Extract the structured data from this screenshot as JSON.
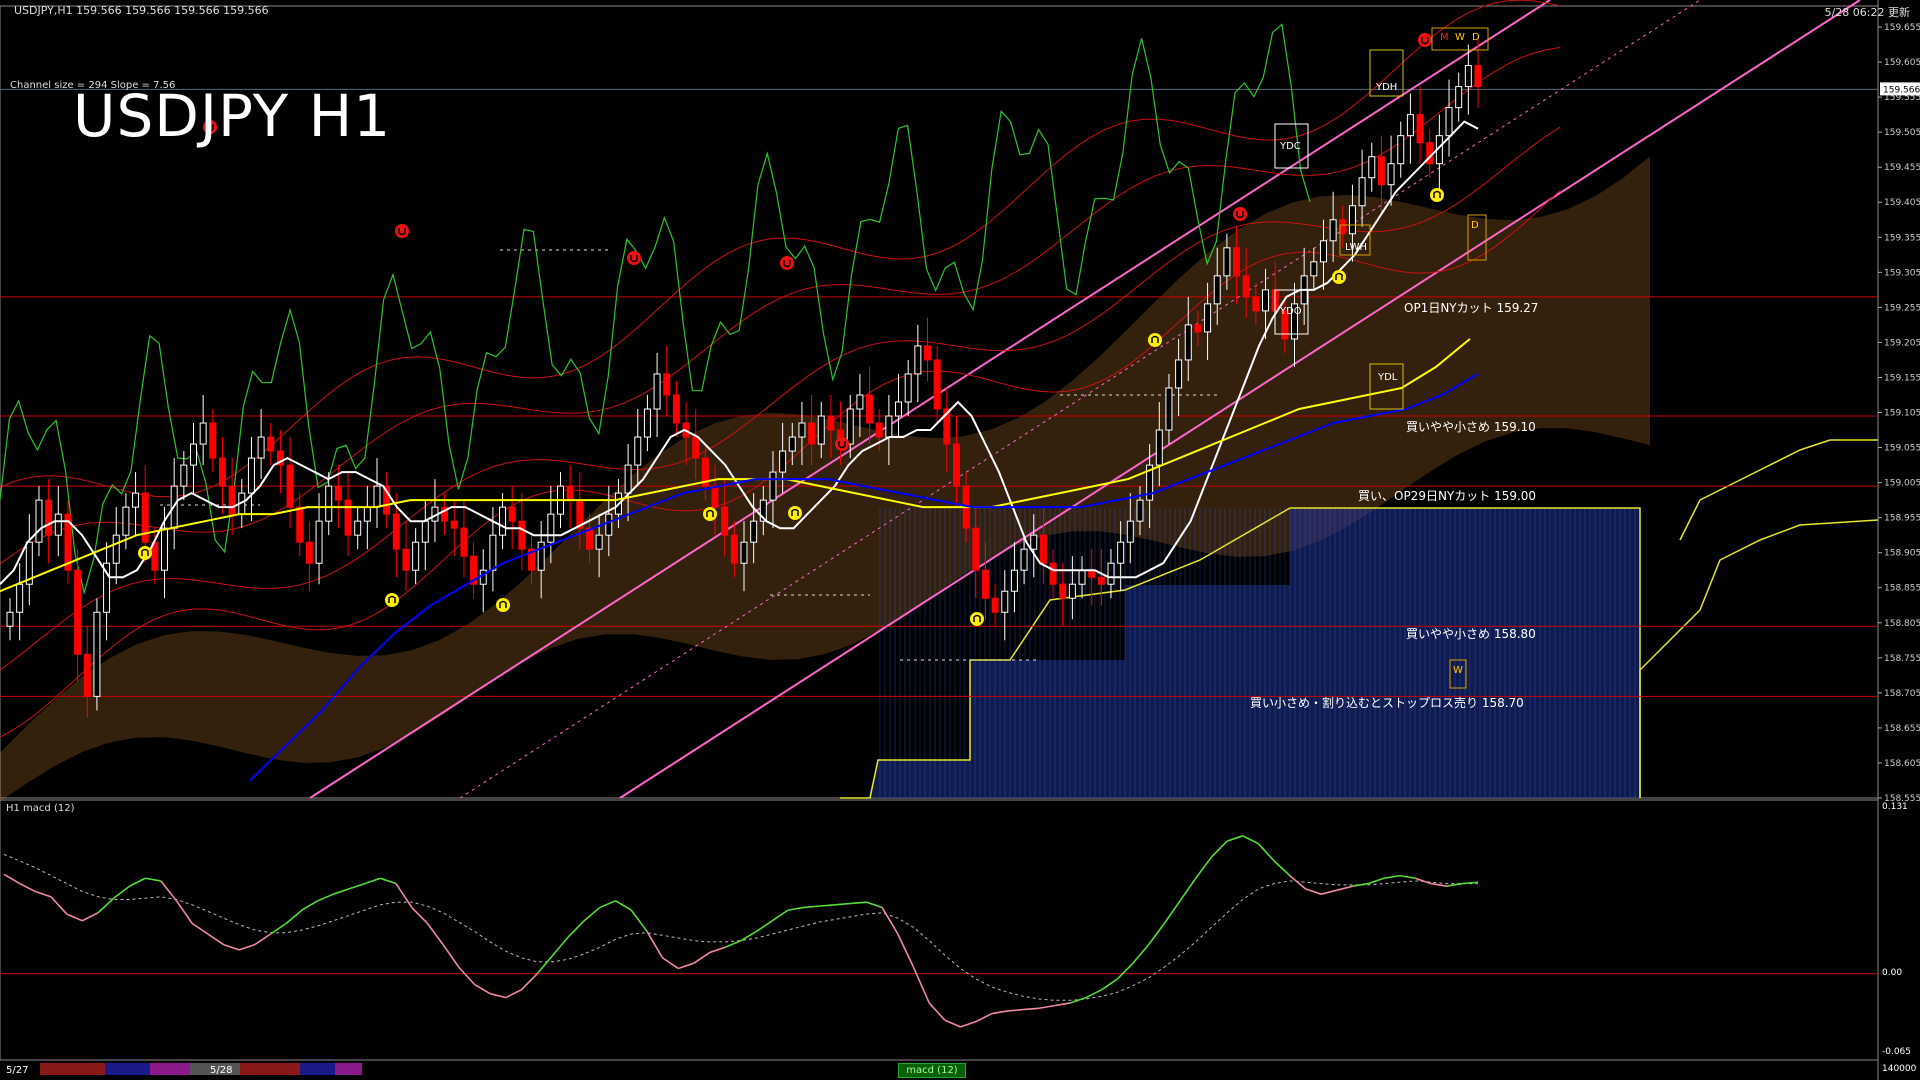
{
  "header": {
    "ohlc": "USDJPY,H1  159.566 159.566 159.566 159.566",
    "datetime": "5/28 06:22 更新",
    "title": "USDJPY H1",
    "channel_info": "Channel size = 294 Slope = 7.56"
  },
  "levels": [
    {
      "price": 159.27,
      "text": "OP1日NYカット 159.27"
    },
    {
      "price": 159.1,
      "text": "買いやや小さめ 159.10"
    },
    {
      "price": 159.0,
      "text": "買い、OP29日NYカット 159.00"
    },
    {
      "price": 158.8,
      "text": "買いやや小さめ 158.80"
    },
    {
      "price": 158.7,
      "text": "買い小さめ・割り込むとストップロス売り 158.70"
    }
  ],
  "box_labels": {
    "ydh": "YDH",
    "ydc": "YDC",
    "ydo": "YDO",
    "ydl": "YDL",
    "lwh": "LWH",
    "m": "M",
    "w": "W",
    "d": "D",
    "d2": "D",
    "w2": "W"
  },
  "macd": {
    "label": "H1  macd (12)",
    "axis_top": "0.131",
    "axis_zero": "0.00",
    "axis_bottom": "-0.065"
  },
  "footer": {
    "date1": "5/27",
    "date2": "5/28",
    "macd_tab": "macd (12)",
    "volume": "140000"
  },
  "colors": {
    "bull": "#ffffff",
    "bear": "#ff0000",
    "sma_short": "#ffffff",
    "sma_mid": "#ffff00",
    "sma_long": "#0000ff",
    "channel": "#ff66cc",
    "level_line": "#cc0000",
    "macd_main": "#55dd33",
    "macd_signal": "#bbbbbb"
  },
  "chart_data": {
    "type": "candlestick",
    "symbol": "USDJPY",
    "timeframe": "H1",
    "price_ylim": [
      158.555,
      159.685
    ],
    "price_ticks": [
      "159.655",
      "159.605",
      "159.555",
      "159.505",
      "159.455",
      "159.405",
      "159.355",
      "159.305",
      "159.255",
      "159.205",
      "159.155",
      "159.105",
      "159.055",
      "159.005",
      "158.955",
      "158.905",
      "158.855",
      "158.805",
      "158.755",
      "158.705",
      "158.655",
      "158.605",
      "158.555"
    ],
    "current_price": "159.566",
    "closes": [
      158.82,
      158.86,
      158.92,
      158.98,
      158.93,
      158.96,
      158.88,
      158.76,
      158.7,
      158.82,
      158.89,
      158.93,
      158.97,
      158.99,
      158.92,
      158.88,
      158.94,
      159.0,
      159.03,
      159.06,
      159.09,
      159.04,
      159.0,
      158.96,
      158.99,
      159.04,
      159.07,
      159.05,
      159.03,
      158.97,
      158.92,
      158.89,
      158.95,
      159.0,
      158.98,
      158.93,
      158.95,
      158.97,
      159.0,
      158.96,
      158.91,
      158.88,
      158.92,
      158.95,
      158.97,
      158.95,
      158.94,
      158.9,
      158.86,
      158.88,
      158.93,
      158.97,
      158.95,
      158.91,
      158.88,
      158.92,
      158.96,
      159.0,
      158.98,
      158.94,
      158.91,
      158.93,
      158.96,
      158.99,
      159.03,
      159.07,
      159.11,
      159.16,
      159.13,
      159.09,
      159.07,
      159.04,
      159.0,
      158.97,
      158.93,
      158.89,
      158.92,
      158.95,
      158.98,
      159.02,
      159.05,
      159.07,
      159.09,
      159.06,
      159.1,
      159.08,
      159.06,
      159.11,
      159.13,
      159.09,
      159.07,
      159.1,
      159.12,
      159.16,
      159.2,
      159.18,
      159.11,
      159.06,
      159.0,
      158.94,
      158.88,
      158.84,
      158.82,
      158.85,
      158.88,
      158.91,
      158.93,
      158.89,
      158.86,
      158.84,
      158.86,
      158.88,
      158.87,
      158.86,
      158.89,
      158.92,
      158.95,
      158.98,
      159.03,
      159.08,
      159.14,
      159.18,
      159.23,
      159.22,
      159.26,
      159.3,
      159.34,
      159.3,
      159.27,
      159.25,
      159.28,
      159.25,
      159.21,
      159.26,
      159.3,
      159.32,
      159.35,
      159.38,
      159.36,
      159.4,
      159.44,
      159.47,
      159.43,
      159.46,
      159.5,
      159.53,
      159.49,
      159.46,
      159.5,
      159.54,
      159.57,
      159.6,
      159.57
    ],
    "sma": [
      {
        "name": "white",
        "values": [
          158.86,
          158.88,
          158.92,
          158.94,
          158.95,
          158.95,
          158.93,
          158.9,
          158.87,
          158.87,
          158.88,
          158.91,
          158.95,
          158.98,
          158.99,
          158.98,
          158.97,
          158.97,
          158.98,
          159.0,
          159.03,
          159.04,
          159.03,
          159.02,
          159.01,
          159.02,
          159.02,
          159.01,
          159.0,
          158.97,
          158.95,
          158.95,
          158.96,
          158.97,
          158.97,
          158.96,
          158.95,
          158.94,
          158.94,
          158.93,
          158.93,
          158.93,
          158.94,
          158.95,
          158.96,
          158.97,
          158.99,
          159.01,
          159.04,
          159.07,
          159.08,
          159.07,
          159.05,
          159.03,
          159.0,
          158.97,
          158.95,
          158.94,
          158.94,
          158.96,
          158.98,
          159.0,
          159.03,
          159.05,
          159.06,
          159.07,
          159.07,
          159.08,
          159.08,
          159.1,
          159.12,
          159.1,
          159.06,
          159.02,
          158.97,
          158.92,
          158.89,
          158.88,
          158.88,
          158.88,
          158.88,
          158.87,
          158.87,
          158.87,
          158.88,
          158.89,
          158.92,
          158.95,
          159.0,
          159.05,
          159.1,
          159.15,
          159.2,
          159.24,
          159.27,
          159.28,
          159.28,
          159.29,
          159.31,
          159.33,
          159.36,
          159.39,
          159.42,
          159.44,
          159.46,
          159.48,
          159.5,
          159.52,
          159.51
        ]
      },
      {
        "name": "yellow",
        "values": [
          158.85,
          158.87,
          158.89,
          158.91,
          158.93,
          158.94,
          158.95,
          158.96,
          158.96,
          158.97,
          158.97,
          158.97,
          158.98,
          158.98,
          158.98,
          158.98,
          158.98,
          158.98,
          158.98,
          158.99,
          159.0,
          159.01,
          159.01,
          159.01,
          159.0,
          158.99,
          158.98,
          158.97,
          158.97,
          158.97,
          158.98,
          158.99,
          159.0,
          159.01,
          159.03,
          159.05,
          159.07,
          159.09,
          159.11,
          159.12,
          159.13,
          159.14,
          159.17,
          159.21
        ]
      },
      {
        "name": "blue",
        "values": [
          158.58,
          158.63,
          158.68,
          158.74,
          158.79,
          158.83,
          158.86,
          158.89,
          158.91,
          158.93,
          158.95,
          158.97,
          158.99,
          159.0,
          159.01,
          159.01,
          159.01,
          159.0,
          158.99,
          158.98,
          158.97,
          158.97,
          158.97,
          158.97,
          158.98,
          158.99,
          159.01,
          159.03,
          159.05,
          159.07,
          159.09,
          159.1,
          159.11,
          159.13,
          159.16
        ]
      }
    ],
    "macd": {
      "main": [
        0.075,
        0.068,
        0.062,
        0.058,
        0.045,
        0.04,
        0.046,
        0.057,
        0.066,
        0.072,
        0.07,
        0.055,
        0.038,
        0.03,
        0.022,
        0.018,
        0.022,
        0.03,
        0.038,
        0.048,
        0.055,
        0.06,
        0.064,
        0.068,
        0.072,
        0.068,
        0.05,
        0.038,
        0.022,
        0.005,
        -0.008,
        -0.015,
        -0.018,
        -0.012,
        0.0,
        0.014,
        0.028,
        0.04,
        0.05,
        0.055,
        0.048,
        0.032,
        0.012,
        0.004,
        0.008,
        0.016,
        0.02,
        0.025,
        0.032,
        0.04,
        0.048,
        0.05,
        0.051,
        0.052,
        0.053,
        0.054,
        0.05,
        0.03,
        0.005,
        -0.022,
        -0.035,
        -0.04,
        -0.036,
        -0.03,
        -0.028,
        -0.027,
        -0.026,
        -0.024,
        -0.022,
        -0.018,
        -0.012,
        -0.004,
        0.008,
        0.022,
        0.038,
        0.055,
        0.072,
        0.088,
        0.1,
        0.104,
        0.098,
        0.085,
        0.074,
        0.064,
        0.06,
        0.063,
        0.066,
        0.068,
        0.072,
        0.074,
        0.072,
        0.068,
        0.066,
        0.068,
        0.069
      ],
      "signal": [
        0.09,
        0.085,
        0.08,
        0.074,
        0.068,
        0.062,
        0.058,
        0.056,
        0.056,
        0.057,
        0.058,
        0.056,
        0.052,
        0.047,
        0.042,
        0.037,
        0.033,
        0.031,
        0.031,
        0.033,
        0.036,
        0.04,
        0.044,
        0.048,
        0.052,
        0.054,
        0.054,
        0.051,
        0.046,
        0.039,
        0.032,
        0.024,
        0.017,
        0.012,
        0.009,
        0.009,
        0.011,
        0.015,
        0.02,
        0.026,
        0.03,
        0.031,
        0.029,
        0.027,
        0.025,
        0.024,
        0.024,
        0.025,
        0.027,
        0.03,
        0.033,
        0.036,
        0.039,
        0.041,
        0.043,
        0.045,
        0.046,
        0.042,
        0.035,
        0.025,
        0.014,
        0.004,
        -0.004,
        -0.01,
        -0.014,
        -0.017,
        -0.019,
        -0.02,
        -0.02,
        -0.019,
        -0.017,
        -0.014,
        -0.009,
        -0.003,
        0.005,
        0.014,
        0.024,
        0.035,
        0.046,
        0.056,
        0.064,
        0.068,
        0.07,
        0.069,
        0.068,
        0.067,
        0.067,
        0.067,
        0.068,
        0.069,
        0.07,
        0.069,
        0.068,
        0.068,
        0.068
      ]
    }
  }
}
